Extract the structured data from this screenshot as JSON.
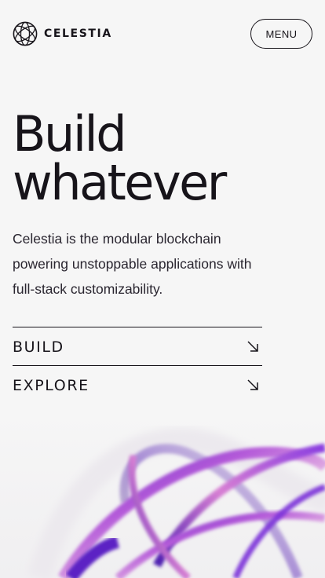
{
  "header": {
    "logo_text": "CELESTIA",
    "logo_icon": "celestia-orbit-logo-icon",
    "menu_label": "MENU"
  },
  "hero": {
    "title_line1": "Build",
    "title_line2": "whatever",
    "description": "Celestia is the modular blockchain powering unstoppable applications with full-stack customizability."
  },
  "links": [
    {
      "label": "BUILD",
      "icon": "arrow-down-right-icon"
    },
    {
      "label": "EXPLORE",
      "icon": "arrow-down-right-icon"
    }
  ],
  "colors": {
    "background": "#f6f6f6",
    "text": "#17141a",
    "accent_purple": "#6b2bd9",
    "accent_pink": "#d86fd0"
  }
}
